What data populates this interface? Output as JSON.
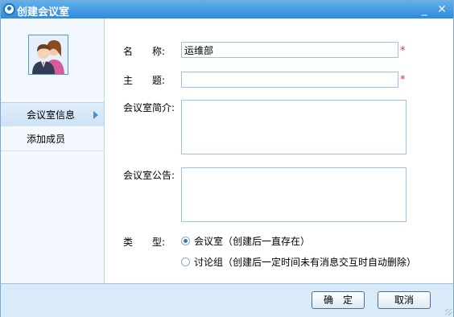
{
  "window": {
    "title": "创建会议室",
    "minimize_glyph": "_",
    "close_glyph": "✕"
  },
  "sidebar": {
    "items": [
      {
        "label": "会议室信息",
        "selected": true
      },
      {
        "label": "添加成员",
        "selected": false
      }
    ]
  },
  "form": {
    "name_label": "名　　称:",
    "name_value": "运维部",
    "topic_label": "主　　题:",
    "topic_value": "",
    "required_mark": "*",
    "intro_label": "会议室简介:",
    "notice_label": "会议室公告:",
    "type_label": "类　　型:",
    "type_options": [
      {
        "label": "会议室（创建后一直存在）",
        "selected": true
      },
      {
        "label": "讨论组（创建后一定时间未有消息交互时自动删除）",
        "selected": false
      }
    ]
  },
  "footer": {
    "ok_label": "确　定",
    "cancel_label": "取消"
  },
  "icons": {
    "app": "app-logo-icon",
    "avatar": "group-users-icon",
    "nav_arrow": "arrow-right-icon"
  },
  "colors": {
    "titlebar": "#2f8ad8",
    "required": "#e03030",
    "border": "#9cc2e3",
    "footer": "#d9eaf8"
  }
}
